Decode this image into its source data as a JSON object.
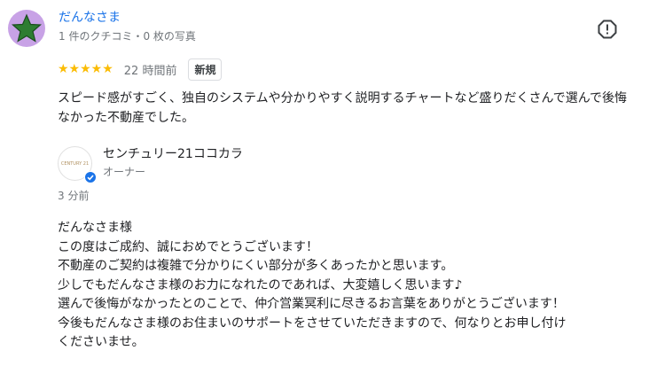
{
  "reviewer": {
    "name": "だんなさま",
    "meta": "1 件のクチコミ・0 枚の写真",
    "avatar_icon": "green-star-icon"
  },
  "report_icon": "flag-alert-icon",
  "review": {
    "rating": 5,
    "stars": "★★★★★",
    "time": "22 時間前",
    "badge": "新規",
    "text": "スピード感がすごく、独自のシステムや分かりやすく説明するチャートなど盛りだくさんで選んで後悔なかった不動産でした。"
  },
  "owner": {
    "logo_text": "CENTURY 21",
    "name": "センチュリー21ココカラ",
    "role": "オーナー",
    "reply_time": "3 分前",
    "reply_lines": [
      "だんなさま様",
      "この度はご成約、誠におめでとうございます！",
      "不動産のご契約は複雑で分かりにくい部分が多くあったかと思います。",
      "少しでもだんなさま様のお力になれたのであれば、大変嬉しく思います♪",
      "選んで後悔がなかったとのことで、仲介営業冥利に尽きるお言葉をありがとうございます！",
      "今後もだんなさま様のお住まいのサポートをさせていただきますので、何なりとお申し付け",
      "くださいませ。"
    ]
  },
  "colors": {
    "name_link": "#1a73e8",
    "star": "#fbbc04",
    "secondary_text": "#70757a",
    "avatar_bg": "#c8a2e6",
    "verified": "#1a73e8"
  }
}
